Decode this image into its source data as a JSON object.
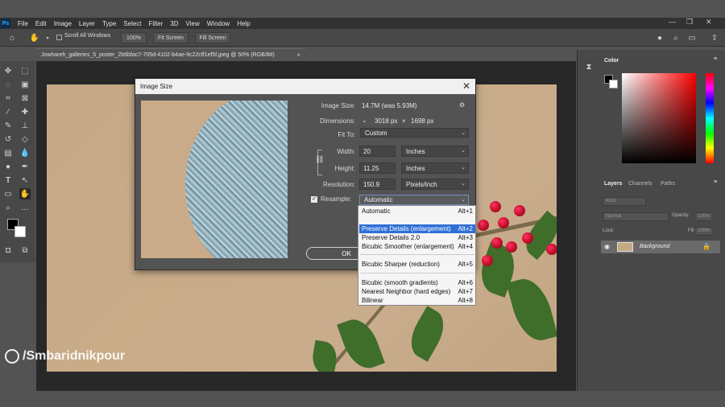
{
  "menu": {
    "logo": "Ps",
    "items": [
      "File",
      "Edit",
      "Image",
      "Layer",
      "Type",
      "Select",
      "Filter",
      "3D",
      "View",
      "Window",
      "Help"
    ]
  },
  "options_bar": {
    "scroll_all_windows": "Scroll All Windows",
    "zoom_100": "100%",
    "fit_screen": "Fit Screen",
    "fill_screen": "Fill Screen"
  },
  "document": {
    "tab_title": "Jowhareh_galleries_5_poster_2b6bfac7-705d-4102-b4ae-9c22cff1ef5f.jpeg @ 50% (RGB/8#)"
  },
  "watermark": "/Smbaridnikpour",
  "panels": {
    "color_tab": "Color",
    "layers_tab": "Layers",
    "channels_tab": "Channels",
    "paths_tab": "Paths",
    "kind": "Kind",
    "blend_mode": "Normal",
    "opacity_label": "Opacity:",
    "opacity_value": "100%",
    "lock_label": "Lock:",
    "fill_label": "Fill:",
    "fill_value": "100%",
    "layer_name": "Background"
  },
  "dialog": {
    "title": "Image Size",
    "image_size_label": "Image Size:",
    "image_size_value": "14.7M (was 5.93M)",
    "dimensions_label": "Dimensions:",
    "dim_w": "3018 px",
    "dim_x": "×",
    "dim_h": "1698 px",
    "fit_to_label": "Fit To:",
    "fit_to_value": "Custom",
    "width_label": "Width:",
    "width_value": "20",
    "width_unit": "Inches",
    "height_label": "Height:",
    "height_value": "11.25",
    "height_unit": "Inches",
    "resolution_label": "Resolution:",
    "resolution_value": "150.9",
    "resolution_unit": "Pixels/Inch",
    "resample_label": "Resample:",
    "resample_value": "Automatic",
    "ok_label": "OK"
  },
  "resample_menu": [
    {
      "label": "Automatic",
      "shortcut": "Alt+1"
    },
    {
      "label": "Preserve Details (enlargement)",
      "shortcut": "Alt+2"
    },
    {
      "label": "Preserve Details 2.0",
      "shortcut": "Alt+3"
    },
    {
      "label": "Bicubic Smoother (enlargement)",
      "shortcut": "Alt+4"
    },
    {
      "label": "Bicubic Sharper (reduction)",
      "shortcut": "Alt+5"
    },
    {
      "label": "Bicubic (smooth gradients)",
      "shortcut": "Alt+6"
    },
    {
      "label": "Nearest Neighbor (hard edges)",
      "shortcut": "Alt+7"
    },
    {
      "label": "Bilinear",
      "shortcut": "Alt+8"
    }
  ],
  "colors": {
    "accent": "#2f6fd7",
    "app_bg": "#535353",
    "menu_bg": "#323232"
  }
}
